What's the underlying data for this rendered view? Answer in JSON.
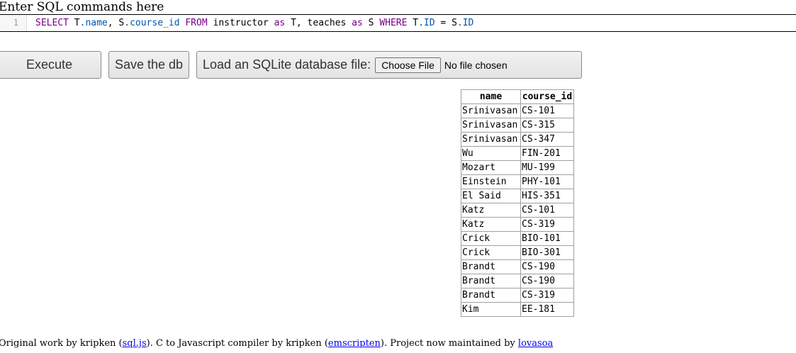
{
  "heading": "Enter SQL commands here",
  "editor": {
    "line_number": "1",
    "tokens": [
      {
        "text": "SELECT ",
        "cls": "kw"
      },
      {
        "text": "T",
        "cls": "plain"
      },
      {
        "text": ".name",
        "cls": "prop"
      },
      {
        "text": ", ",
        "cls": "plain"
      },
      {
        "text": "S",
        "cls": "plain"
      },
      {
        "text": ".course_id",
        "cls": "prop"
      },
      {
        "text": " FROM ",
        "cls": "kw"
      },
      {
        "text": "instructor ",
        "cls": "plain"
      },
      {
        "text": "as",
        "cls": "kw"
      },
      {
        "text": " T, teaches ",
        "cls": "plain"
      },
      {
        "text": "as",
        "cls": "kw"
      },
      {
        "text": " S ",
        "cls": "plain"
      },
      {
        "text": "WHERE",
        "cls": "kw"
      },
      {
        "text": " T",
        "cls": "plain"
      },
      {
        "text": ".ID",
        "cls": "prop"
      },
      {
        "text": " = ",
        "cls": "plain"
      },
      {
        "text": "S",
        "cls": "plain"
      },
      {
        "text": ".ID",
        "cls": "prop"
      }
    ]
  },
  "toolbar": {
    "execute_label": "Execute",
    "save_label": "Save the db",
    "load_label": "Load an SQLite database file:",
    "choose_file_label": "Choose File",
    "file_status": "No file chosen"
  },
  "results": {
    "columns": [
      "name",
      "course_id"
    ],
    "rows": [
      [
        "Srinivasan",
        "CS-101"
      ],
      [
        "Srinivasan",
        "CS-315"
      ],
      [
        "Srinivasan",
        "CS-347"
      ],
      [
        "Wu",
        "FIN-201"
      ],
      [
        "Mozart",
        "MU-199"
      ],
      [
        "Einstein",
        "PHY-101"
      ],
      [
        "El Said",
        "HIS-351"
      ],
      [
        "Katz",
        "CS-101"
      ],
      [
        "Katz",
        "CS-319"
      ],
      [
        "Crick",
        "BIO-101"
      ],
      [
        "Crick",
        "BIO-301"
      ],
      [
        "Brandt",
        "CS-190"
      ],
      [
        "Brandt",
        "CS-190"
      ],
      [
        "Brandt",
        "CS-319"
      ],
      [
        "Kim",
        "EE-181"
      ]
    ]
  },
  "footer": {
    "text1": "Original work by kripken (",
    "link1": "sql.js",
    "text2": "). C to Javascript compiler by kripken (",
    "link2": "emscripten",
    "text3": "). Project now maintained by ",
    "link3": "lovasoa"
  }
}
